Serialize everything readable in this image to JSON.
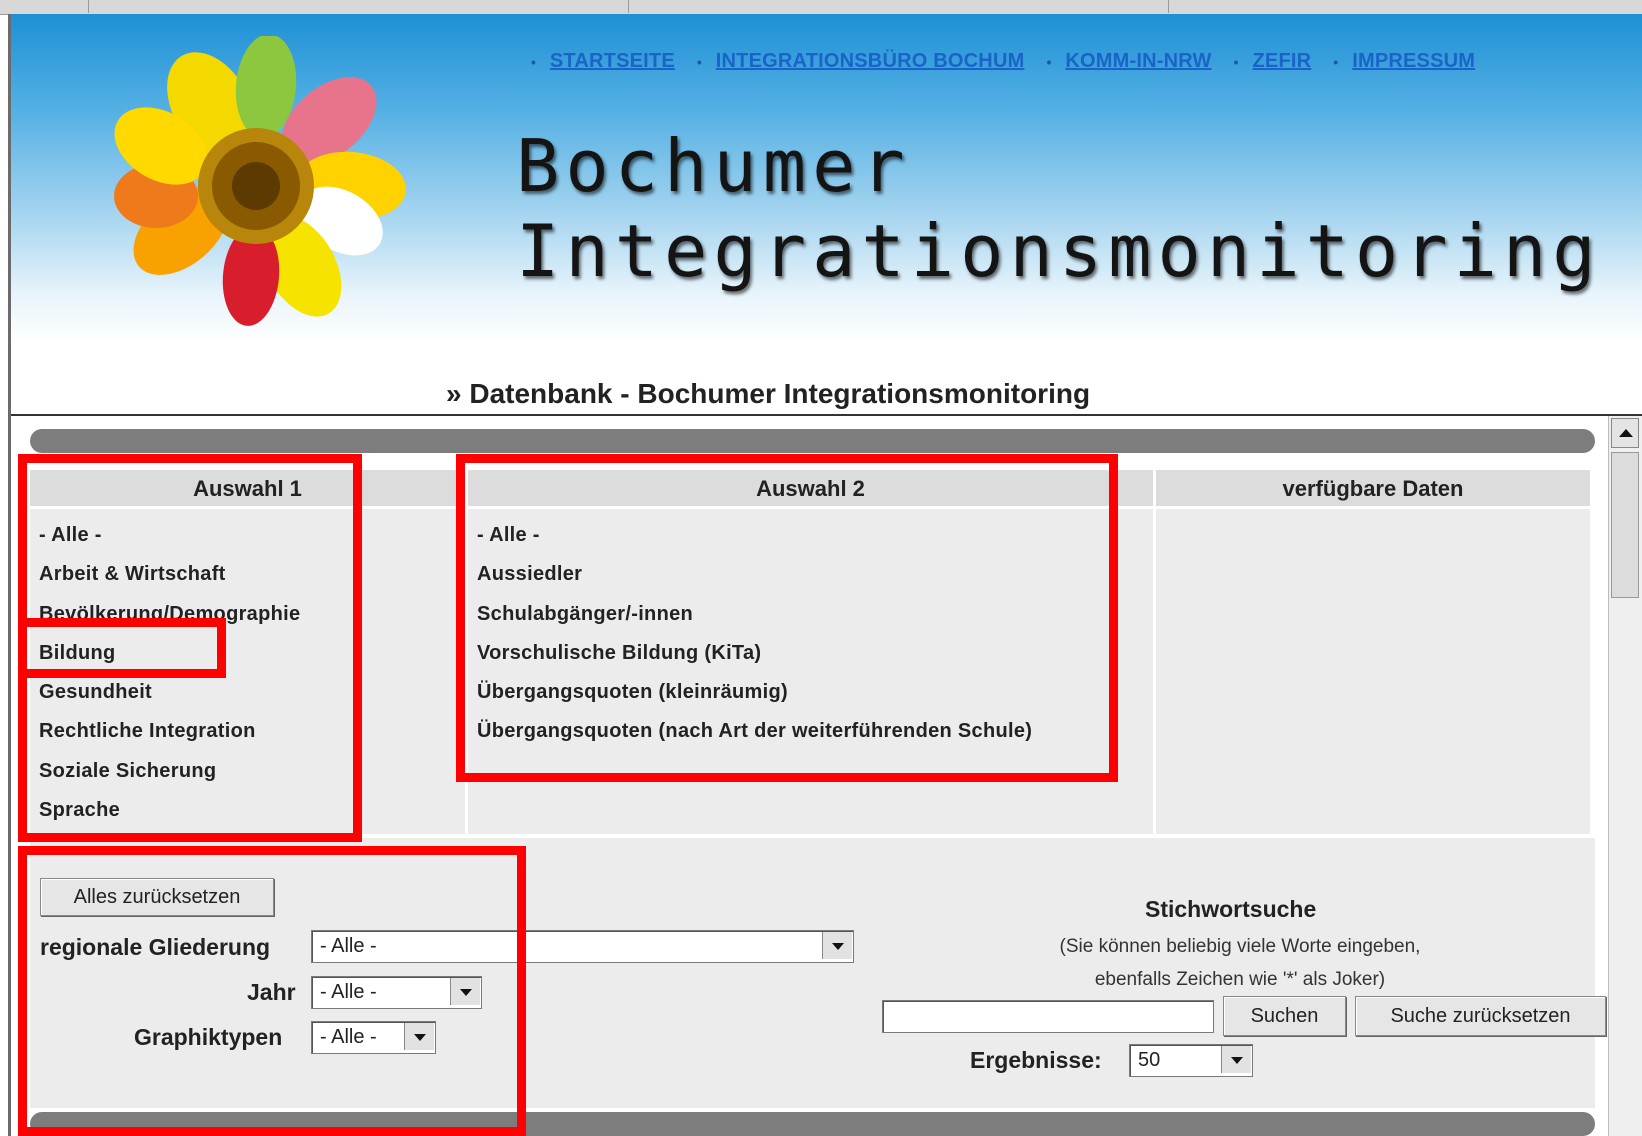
{
  "nav": {
    "links": [
      "STARTSEITE",
      "INTEGRATIONSBÜRO BOCHUM",
      "KOMM-IN-NRW",
      "ZEFIR",
      "IMPRESSUM"
    ]
  },
  "header": {
    "title_line1": "Bochumer",
    "title_line2": "Integrationsmonitoring"
  },
  "page": {
    "subheading": "» Datenbank - Bochumer Integrationsmonitoring"
  },
  "auswahl1": {
    "title": "Auswahl 1",
    "items": [
      "- Alle -",
      "Arbeit & Wirtschaft",
      "Bevölkerung/Demographie",
      "Bildung",
      "Gesundheit",
      "Rechtliche Integration",
      "Soziale Sicherung",
      "Sprache"
    ]
  },
  "auswahl2": {
    "title": "Auswahl 2",
    "items": [
      "- Alle -",
      "Aussiedler",
      "Schulabgänger/-innen",
      "Vorschulische Bildung (KiTa)",
      "Übergangsquoten (kleinräumig)",
      "Übergangsquoten (nach Art der weiterführenden Schule)"
    ]
  },
  "verfuegbar": {
    "title": "verfügbare Daten"
  },
  "filters": {
    "reset_all": "Alles zurücksetzen",
    "regional_label": "regionale Gliederung",
    "regional_value": "- Alle -",
    "jahr_label": "Jahr",
    "jahr_value": "- Alle -",
    "graphik_label": "Graphiktypen",
    "graphik_value": "- Alle -"
  },
  "search": {
    "title": "Stichwortsuche",
    "help_line1": "(Sie können beliebig viele Worte eingeben,",
    "help_line2": "ebenfalls Zeichen wie '*' als Joker)",
    "input_value": "",
    "search_button": "Suchen",
    "reset_button": "Suche zurücksetzen",
    "results_label": "Ergebnisse:",
    "results_value": "50"
  },
  "colors": {
    "highlight": "#ff0000",
    "link": "#1a64c8",
    "header_top": "#1e90d6"
  }
}
